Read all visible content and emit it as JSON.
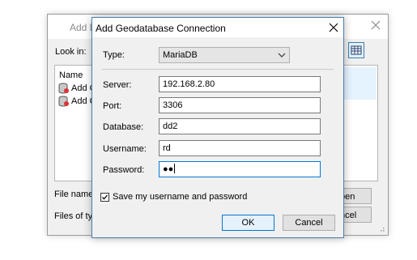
{
  "background_window": {
    "title": "Add D",
    "look_in_label": "Look in:",
    "list_header": "Name",
    "items": [
      "Add G",
      "Add C"
    ],
    "file_name_label": "File name:",
    "files_of_type_label": "Files of typ",
    "open_button": "pen",
    "cancel_button": "ncel"
  },
  "dialog": {
    "title": "Add Geodatabase Connection",
    "type_label": "Type:",
    "type_value": "MariaDB",
    "server_label": "Server:",
    "server_value": "192.168.2.80",
    "port_label": "Port:",
    "port_value": "3306",
    "database_label": "Database:",
    "database_value": "dd2",
    "username_label": "Username:",
    "username_value": "rd",
    "password_label": "Password:",
    "password_value": "●●",
    "save_credentials_label": "Save my username and password",
    "save_credentials_checked": true,
    "ok_button": "OK",
    "cancel_button": "Cancel"
  },
  "colors": {
    "focus_border": "#0078d7",
    "dialog_border": "#4a7eb0"
  }
}
